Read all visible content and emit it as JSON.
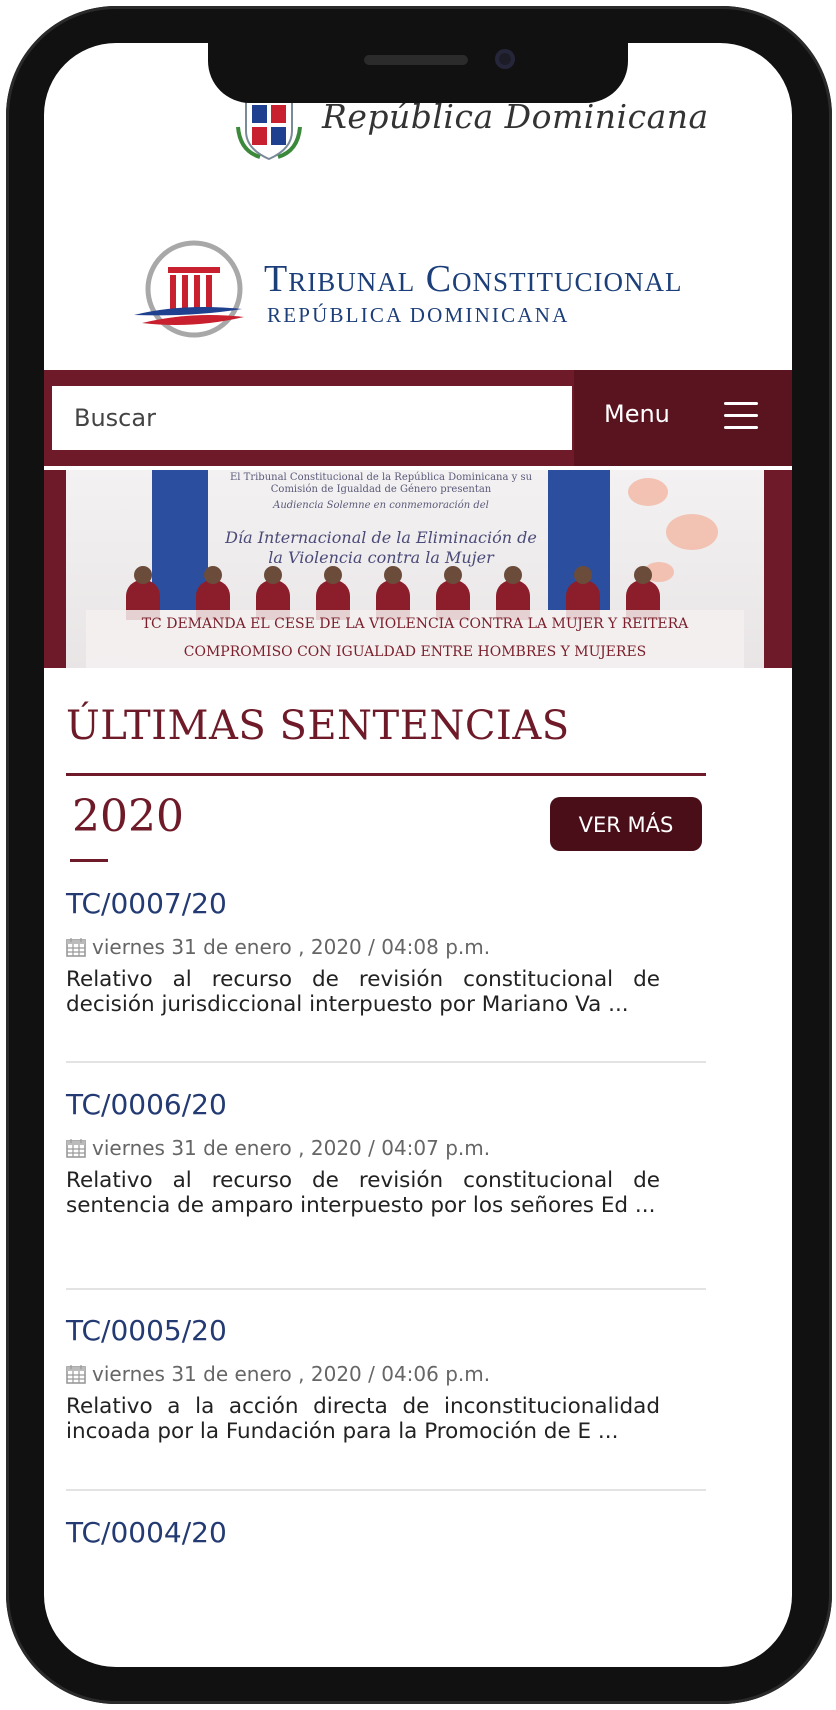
{
  "header": {
    "government_name": "República Dominicana",
    "institution_title": "Tribunal Constitucional",
    "institution_subtitle": "REPÚBLICA DOMINICANA"
  },
  "search": {
    "placeholder": "Buscar"
  },
  "menu": {
    "label": "Menu"
  },
  "banner": {
    "line1": "El Tribunal Constitucional de la República Dominicana y su Comisión de Igualdad de Género presentan",
    "line2": "Audiencia Solemne en conmemoración del",
    "line3": "Día Internacional de la Eliminación de la Violencia contra la Mujer",
    "caption": "TC DEMANDA EL CESE DE LA VIOLENCIA CONTRA LA MUJER Y REITERA COMPROMISO CON IGUALDAD ENTRE HOMBRES Y MUJERES"
  },
  "main": {
    "section_title": "ÚLTIMAS SENTENCIAS",
    "year": "2020",
    "more_label": "VER MÁS",
    "items": [
      {
        "code": "TC/0007/20",
        "date": "viernes 31 de enero , 2020 / 04:08 p.m.",
        "description": "Relativo al recurso de revisión constitucional de decisión jurisdiccional interpuesto por Mariano Va ..."
      },
      {
        "code": "TC/0006/20",
        "date": "viernes 31 de enero , 2020 / 04:07 p.m.",
        "description": "Relativo al recurso de revisión constitucional de sentencia de amparo interpuesto por los señores Ed ..."
      },
      {
        "code": "TC/0005/20",
        "date": "viernes 31 de enero , 2020 / 04:06 p.m.",
        "description": "Relativo a la acción directa de inconstitucionalidad incoada por la Fundación para la Promoción de E ..."
      },
      {
        "code": "TC/0004/20",
        "date": "",
        "description": ""
      }
    ]
  },
  "colors": {
    "brand_maroon": "#6e1a28",
    "button_dark": "#4a0e18",
    "link_blue": "#233a73"
  }
}
